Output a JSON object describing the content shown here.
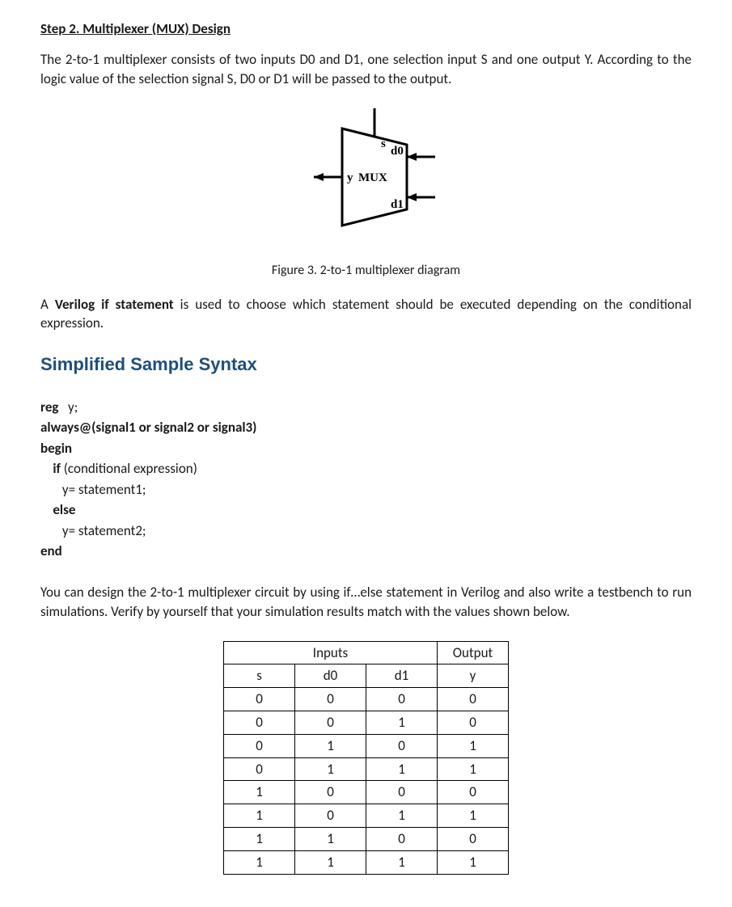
{
  "step_title": "Step 2. Multiplexer (MUX) Design",
  "intro": "The 2-to-1 multiplexer consists of two inputs D0 and D1, one selection input S and one output Y. According to the logic value of the selection signal S, D0 or D1 will be passed to the output.",
  "mux": {
    "s": "s",
    "d0": "d0",
    "d1": "d1",
    "y": "y",
    "label": "MUX"
  },
  "figure_caption": "Figure 3. 2-to-1 multiplexer diagram",
  "para2_a": "A ",
  "para2_b": "Verilog if statement",
  "para2_c": " is used to choose which statement should be executed depending on the conditional expression.",
  "syntax_heading": "Simplified Sample Syntax",
  "code": {
    "l1_a": "reg",
    "l1_b": "   y;",
    "l2": "always@(signal1 or signal2 or signal3)",
    "l3": "begin",
    "l4_a": "    if",
    "l4_b": " (conditional expression)",
    "l5": "       y= statement1;",
    "l6": "    else",
    "l7": "       y= statement2;",
    "l8": "end"
  },
  "para3": "You can design the 2-to-1 multiplexer circuit by using if…else statement in Verilog and also write a testbench to run simulations. Verify by yourself that your simulation results match with the values shown below.",
  "table": {
    "inputs_label": "Inputs",
    "output_label": "Output",
    "cols": [
      "s",
      "d0",
      "d1",
      "y"
    ],
    "rows": [
      [
        "0",
        "0",
        "0",
        "0"
      ],
      [
        "0",
        "0",
        "1",
        "0"
      ],
      [
        "0",
        "1",
        "0",
        "1"
      ],
      [
        "0",
        "1",
        "1",
        "1"
      ],
      [
        "1",
        "0",
        "0",
        "0"
      ],
      [
        "1",
        "0",
        "1",
        "1"
      ],
      [
        "1",
        "1",
        "0",
        "0"
      ],
      [
        "1",
        "1",
        "1",
        "1"
      ]
    ]
  },
  "chart_data": {
    "type": "table",
    "title": "2-to-1 MUX truth table",
    "columns": [
      "s",
      "d0",
      "d1",
      "y"
    ],
    "rows": [
      [
        0,
        0,
        0,
        0
      ],
      [
        0,
        0,
        1,
        0
      ],
      [
        0,
        1,
        0,
        1
      ],
      [
        0,
        1,
        1,
        1
      ],
      [
        1,
        0,
        0,
        0
      ],
      [
        1,
        0,
        1,
        1
      ],
      [
        1,
        1,
        0,
        0
      ],
      [
        1,
        1,
        1,
        1
      ]
    ]
  }
}
